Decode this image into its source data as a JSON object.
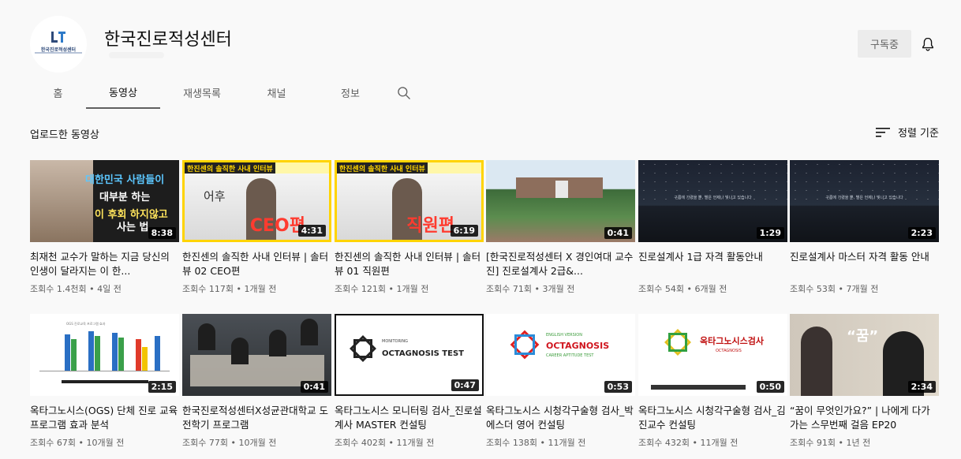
{
  "channel": {
    "name": "한국진로적성센터",
    "logo_text": "한국진로적성센터",
    "subscribe_label": "구독중"
  },
  "tabs": [
    {
      "label": "홈",
      "active": false
    },
    {
      "label": "동영상",
      "active": true
    },
    {
      "label": "재생목록",
      "active": false
    },
    {
      "label": "채널",
      "active": false
    },
    {
      "label": "정보",
      "active": false
    }
  ],
  "section": {
    "title": "업로드한 동영상",
    "sort_label": "정렬 기준"
  },
  "videos": [
    {
      "title": "최재천 교수가 말하는 지금 당신의 인생이 달라지는 이 한...",
      "views": "조회수 1.4천회",
      "age": "4일 전",
      "duration": "8:38",
      "thumb": {
        "l1": "대한민국 사람들이",
        "l2": "대부분 하는",
        "l3": "이 후회 하지않고",
        "l4": "사는 법"
      }
    },
    {
      "title": "한진센의 솔직한 사내 인터뷰 | 솔터뷰 02 CEO편",
      "views": "조회수 117회",
      "age": "1개월 전",
      "duration": "4:31",
      "thumb": {
        "banner": "한진센의 솔직한 사내 인터뷰",
        "word": "어후",
        "big": "CEO편"
      }
    },
    {
      "title": "한진센의 솔직한 사내 인터뷰 | 솔터뷰 01 직원편",
      "views": "조회수 121회",
      "age": "1개월 전",
      "duration": "6:19",
      "thumb": {
        "banner": "한진센의 솔직한 사내 인터뷰",
        "big": "직원편"
      }
    },
    {
      "title": "[한국진로적성센터 X 경인여대 교수진] 진로설계사 2급&...",
      "views": "조회수 71회",
      "age": "3개월 전",
      "duration": "0:41"
    },
    {
      "title": "진로설계사 1급 자격 활동안내",
      "views": "조회수 54회",
      "age": "6개월 전",
      "duration": "1:29",
      "thumb": {
        "caption": "구름에 가렸을 뿐, 별은 언제나 빛나고 있습니다"
      }
    },
    {
      "title": "진로설계사 마스터 자격 활동 안내",
      "views": "조회수 53회",
      "age": "7개월 전",
      "duration": "2:23",
      "thumb": {
        "caption": "구름에 가렸을 뿐, 별은 언제나 빛나고 있습니다"
      }
    },
    {
      "title": "옥타그노시스(OGS) 단체 진로 교육 프로그램 효과 분석",
      "views": "조회수 67회",
      "age": "10개월 전",
      "duration": "2:15",
      "thumb": {
        "head": "OGS 진로교육 프로그램 효과"
      }
    },
    {
      "title": "한국진로적성센터X성균관대학교 도전학기 프로그램",
      "views": "조회수 77회",
      "age": "10개월 전",
      "duration": "0:41"
    },
    {
      "title": "옥타그노시스 모니터링 검사_진로설계사 MASTER 컨설팅",
      "views": "조회수 402회",
      "age": "11개월 전",
      "duration": "0:47",
      "thumb": {
        "small": "MONITORING",
        "label": "OCTAGNOSIS TEST"
      }
    },
    {
      "title": "옥타그노시스 시청각구술형 검사_박에스더 영어 컨설팅",
      "views": "조회수 138회",
      "age": "11개월 전",
      "duration": "0:53",
      "thumb": {
        "small": "ENGLISH VERSION",
        "label": "OCTAGNOSIS",
        "small2": "CAREER APTITUDE TEST"
      }
    },
    {
      "title": "옥타그노시스 시청각구술형 검사_김진교수 컨설팅",
      "views": "조회수 432회",
      "age": "11개월 전",
      "duration": "0:50",
      "thumb": {
        "label": "옥타그노시스검사",
        "small": "OCTAGNOSIS"
      }
    },
    {
      "title": "“꿈이 무엇인가요?” | 나에게 다가가는 스무번째 걸음 EP20",
      "views": "조회수 91회",
      "age": "1년 전",
      "duration": "2:34",
      "thumb": {
        "quote": "“꿈”"
      }
    }
  ],
  "colors": {
    "bg": "#f9f9f9",
    "text": "#0f0f0f",
    "secondary": "#606060",
    "subscribe_bg": "#ececec"
  }
}
